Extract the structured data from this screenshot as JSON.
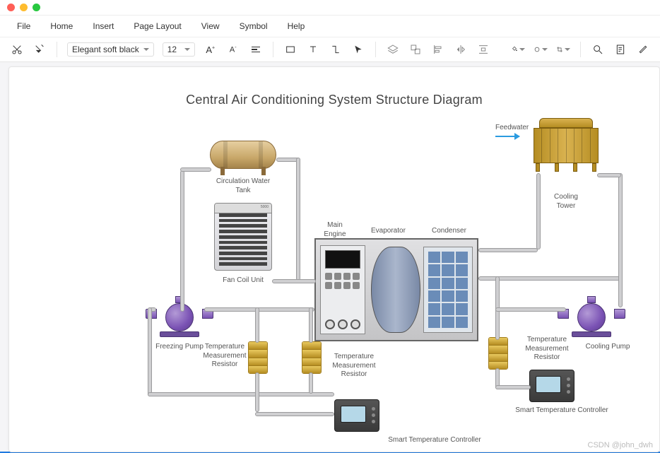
{
  "menu": {
    "items": [
      "File",
      "Home",
      "Insert",
      "Page Layout",
      "View",
      "Symbol",
      "Help"
    ]
  },
  "ribbon": {
    "font_family": "Elegant soft black",
    "font_size": "12"
  },
  "diagram": {
    "title": "Central Air Conditioning System Structure Diagram",
    "labels": {
      "feedwater": "Feedwater",
      "cooling_tower": "Cooling Tower",
      "circulation_tank": "Circulation Water\nTank",
      "fan_coil": "Fan Coil Unit",
      "main_engine": "Main\nEngine",
      "evaporator": "Evaporator",
      "condenser": "Condenser",
      "freezing_pump": "Freezing Pump",
      "cooling_pump": "Cooling Pump",
      "tmr": "Temperature\nMeasurement\nResistor",
      "tmr2": "Temperature\nMeasurement\nResistor",
      "tmr3": "Temperature\nMeasurement Resistor",
      "stc": "Smart Temperature Controller",
      "stc2": "Smart Temperature Controller",
      "fcoil_head": "5000"
    }
  },
  "watermark": "CSDN @john_dwh"
}
